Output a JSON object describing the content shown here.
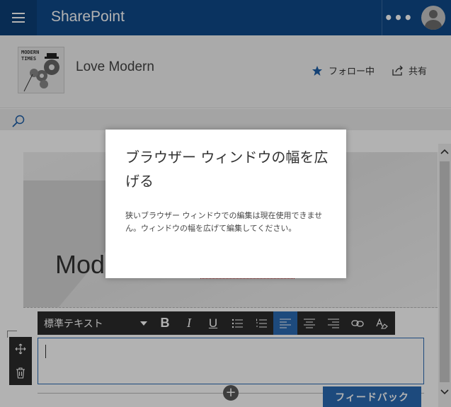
{
  "suitebar": {
    "title": "SharePoint",
    "more_label": "•••"
  },
  "site": {
    "logo_text_line1": "MODERN",
    "logo_text_line2": "TIMES",
    "title": "Love Modern",
    "follow_label": "フォロー中",
    "share_label": "共有"
  },
  "page": {
    "hero_title": "Mod"
  },
  "toolbar": {
    "style_value": "標準テキスト",
    "buttons": [
      "B",
      "I",
      "U"
    ]
  },
  "feedback_label": "フィードバック",
  "dialog": {
    "title": "ブラウザー ウィンドウの幅を広げる",
    "body": "狭いブラウザー ウィンドウでの編集は現在使用できません。ウィンドウの幅を広げて編集してください。"
  },
  "colors": {
    "suitebar": "#0f4a8a",
    "accent": "#2a6bb3",
    "toolbar": "#2b2b2b"
  }
}
